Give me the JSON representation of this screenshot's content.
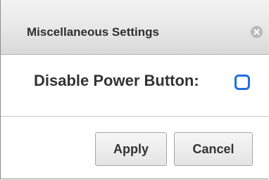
{
  "dialog": {
    "title": "Miscellaneous Settings",
    "close_icon": "close-icon"
  },
  "option": {
    "label": "Disable Power Button:",
    "checked": false
  },
  "buttons": {
    "apply_label": "Apply",
    "cancel_label": "Cancel"
  },
  "colors": {
    "checkbox_accent": "#1f6fe0"
  }
}
